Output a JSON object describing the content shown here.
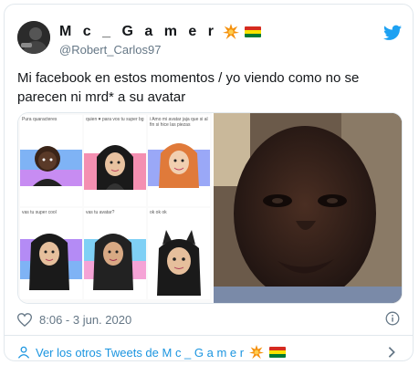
{
  "author": {
    "display_name": "M c _ G a m e r",
    "handle": "@Robert_Carlos97"
  },
  "tweet": {
    "text": "Mi facebook en estos momentos / yo viendo como no se parecen ni mrd* a su avatar",
    "timestamp": "8:06 - 3 jun. 2020"
  },
  "media": {
    "captions": [
      "Pura quaracteres",
      "quien ♥ para\nvos tu super bg",
      "i Amo mi avatar jaja\nque si al fin si hice las piezas",
      "vas tu super cool",
      "vas tu avatar?",
      "ok ok ok"
    ]
  },
  "footer": {
    "more_tweets_label": "Ver los otros Tweets de M c _ G a m e r"
  },
  "icons": {
    "bird": "twitter-bird-icon",
    "heart": "heart-icon",
    "info": "info-icon",
    "person": "person-icon",
    "chevron": "chevron-right-icon"
  },
  "colors": {
    "accent": "#1da1f2",
    "link": "#1b95e0",
    "muted": "#657786",
    "flag_red": "#d52b1e",
    "flag_yellow": "#f9e300",
    "flag_green": "#007934"
  }
}
